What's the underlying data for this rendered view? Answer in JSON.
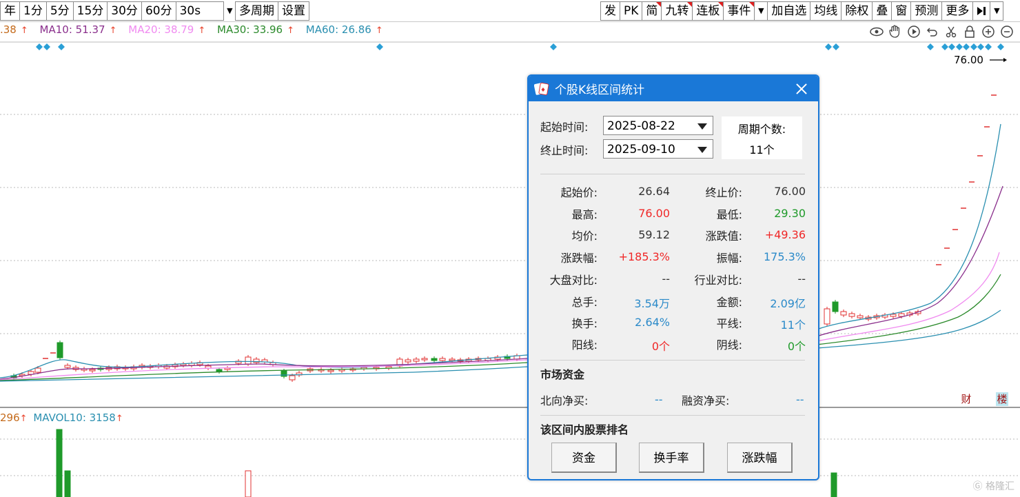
{
  "toolbar": {
    "left": [
      "年",
      "1分",
      "5分",
      "15分",
      "30分",
      "60分"
    ],
    "period_select": "30s",
    "left_after": [
      "多周期",
      "设置"
    ],
    "right": [
      {
        "label": "发",
        "flag": false
      },
      {
        "label": "PK",
        "flag": false
      },
      {
        "label": "简",
        "flag": true
      },
      {
        "label": "九转",
        "flag": true
      },
      {
        "label": "连板",
        "flag": true
      },
      {
        "label": "事件",
        "flag": true
      }
    ],
    "right_after": [
      "加自选",
      "均线",
      "除权",
      "叠",
      "窗",
      "预测",
      "更多"
    ]
  },
  "ma_legend": {
    "ma5": ".38",
    "ma10": "MA10: 51.37",
    "ma20": "MA20: 38.79",
    "ma30": "MA30: 33.96",
    "ma60": "MA60: 26.86",
    "arrow": "↑"
  },
  "vol_legend": {
    "vol": "296",
    "mavol10": "MAVOL10: 3158",
    "arrow": "↑"
  },
  "chart": {
    "price_label": "76.00",
    "cai_badge": "财",
    "lou_badge": "楼"
  },
  "dialog": {
    "title": "个股K线区间统计",
    "start_label": "起始时间:",
    "start_value": "2025-08-22",
    "end_label": "终止时间:",
    "end_value": "2025-09-10",
    "period_label": "周期个数:",
    "period_value": "11个",
    "stats": {
      "open_label": "起始价:",
      "open_value": "26.64",
      "close_label": "终止价:",
      "close_value": "76.00",
      "high_label": "最高:",
      "high_value": "76.00",
      "low_label": "最低:",
      "low_value": "29.30",
      "avg_label": "均价:",
      "avg_value": "59.12",
      "chg_label": "涨跌值:",
      "chg_value": "+49.36",
      "pct_label": "涨跌幅:",
      "pct_value": "+185.3%",
      "amp_label": "振幅:",
      "amp_value": "175.3%",
      "mkt_label": "大盘对比:",
      "mkt_value": "--",
      "ind_label": "行业对比:",
      "ind_value": "--",
      "vol_label": "总手:",
      "vol_value": "3.54万",
      "amt_label": "金额:",
      "amt_value": "2.09亿",
      "turn_label": "换手:",
      "turn_value": "2.64%",
      "flat_label": "平线:",
      "flat_value": "11个",
      "yang_label": "阳线:",
      "yang_value": "0个",
      "yin_label": "阴线:",
      "yin_value": "0个"
    },
    "fund_title": "市场资金",
    "north_label": "北向净买:",
    "north_value": "--",
    "margin_label": "融资净买:",
    "margin_value": "--",
    "rank_title": "该区间内股票排名",
    "buttons": [
      "资金",
      "换手率",
      "涨跌幅"
    ]
  },
  "watermark": "格隆汇"
}
